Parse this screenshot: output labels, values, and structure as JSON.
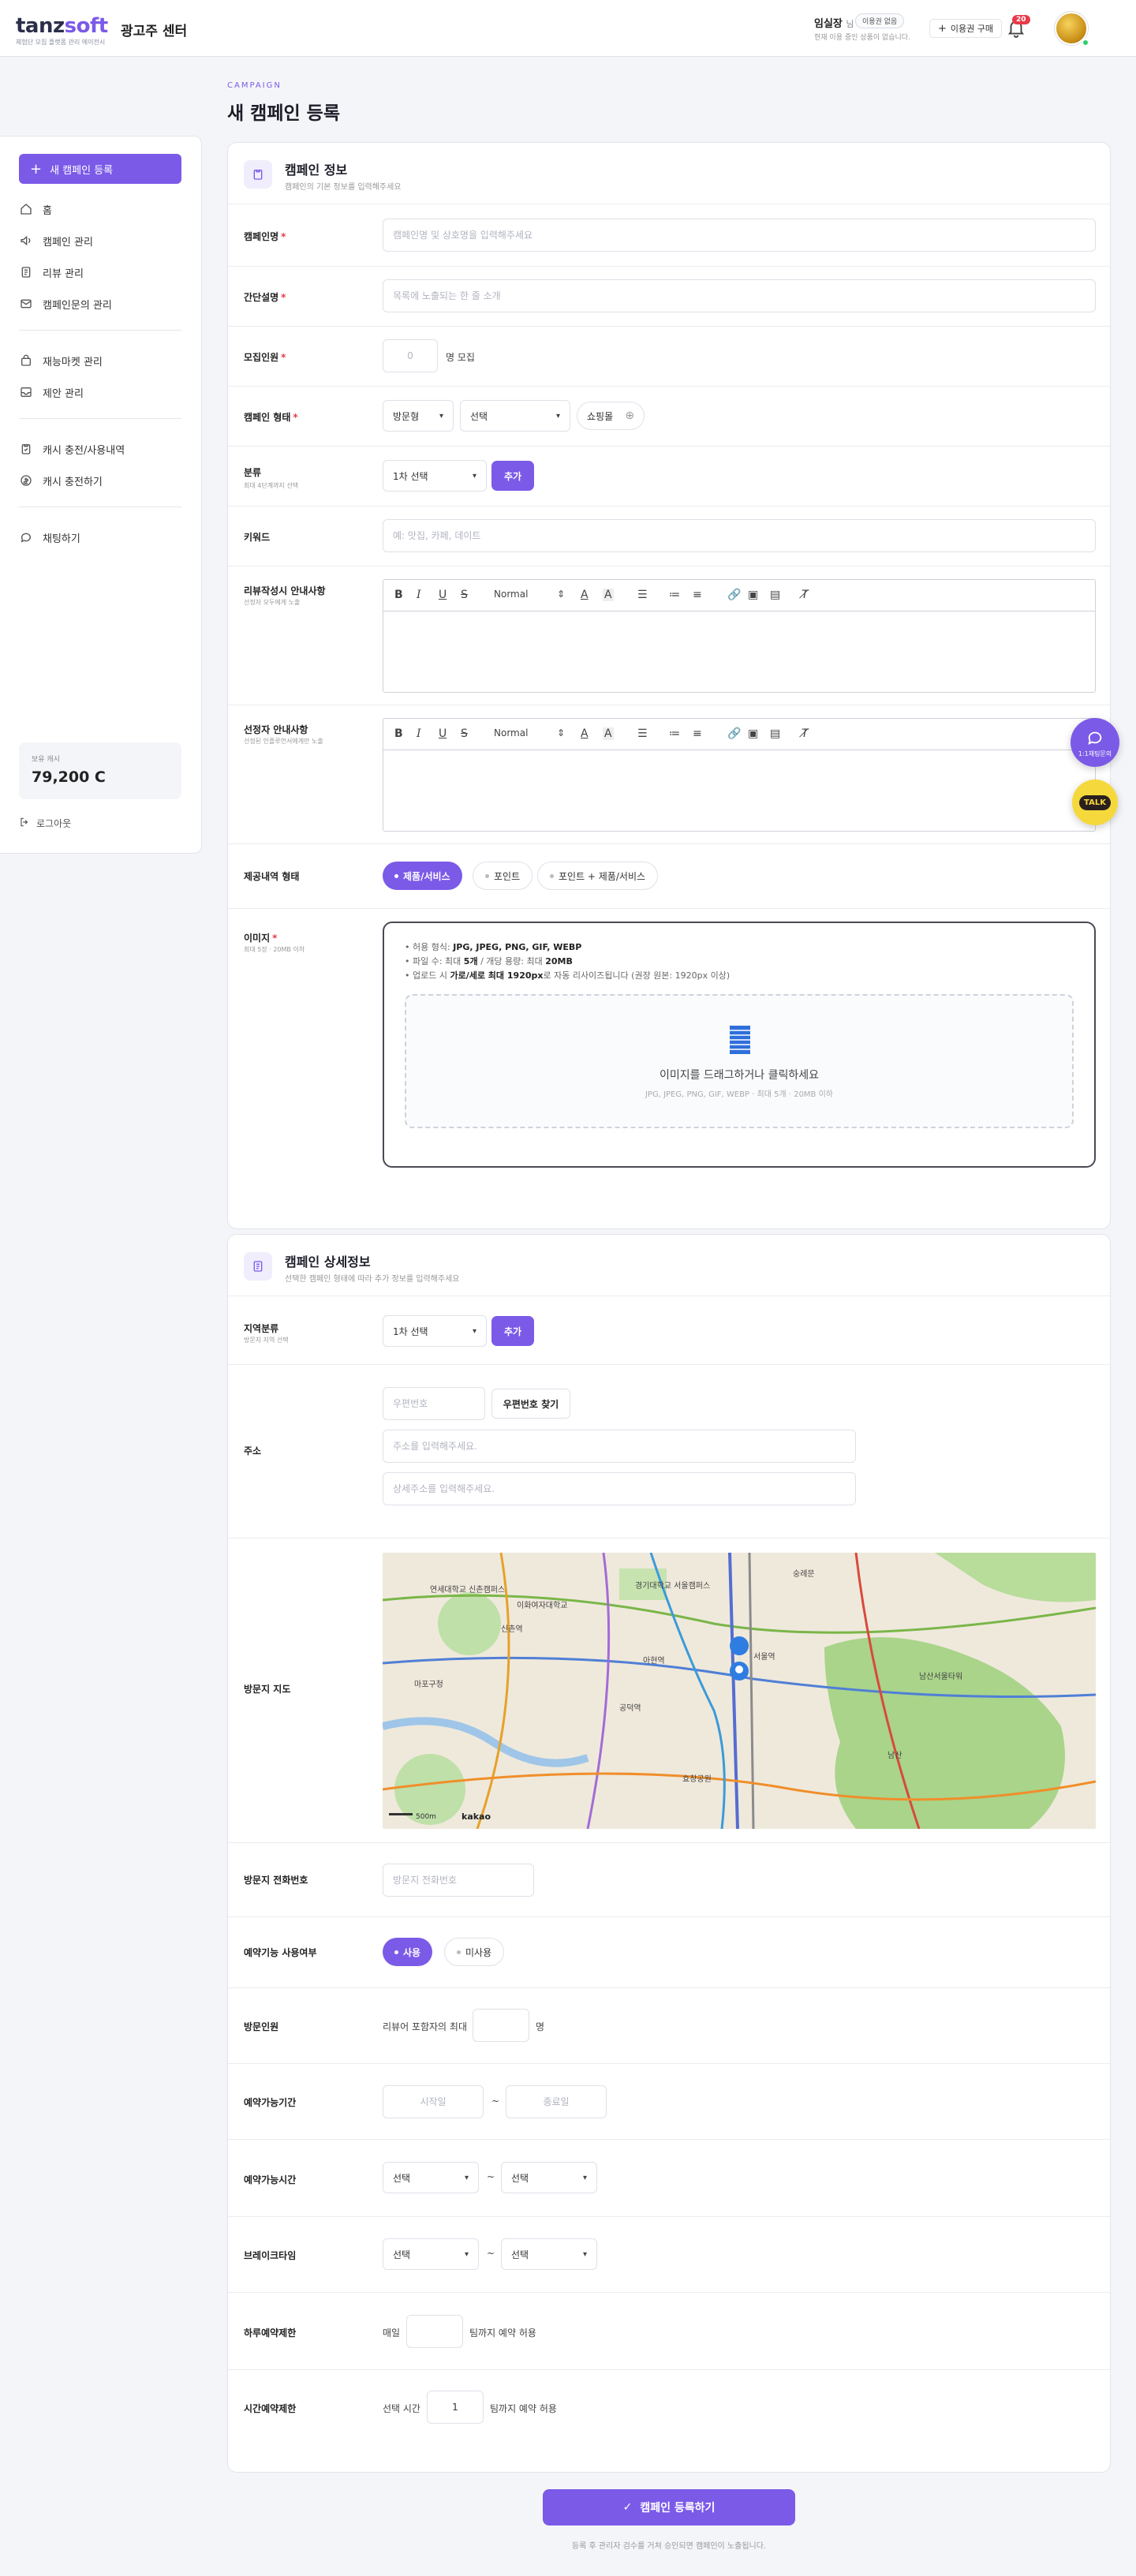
{
  "header": {
    "logo_main": "tanz",
    "logo_accent": "soft",
    "logo_sub": "체험단 모집 플랫폼 관리 에이전시",
    "center_title": "광고주 센터",
    "user_name": "임실장",
    "user_suffix": "님",
    "status_pill": "이용권 없음",
    "user_note": "현재 이용 중인 상품이 없습니다.",
    "buy_button": "이용권 구매",
    "notification_count": "20"
  },
  "sidebar": {
    "new_campaign": "새 캠페인 등록",
    "items": [
      {
        "label": "홈",
        "icon": "home-icon"
      },
      {
        "label": "캠페인 관리",
        "icon": "megaphone-icon"
      },
      {
        "label": "리뷰 관리",
        "icon": "document-icon"
      },
      {
        "label": "캠페인문의 관리",
        "icon": "mail-icon"
      },
      {
        "label": "재능마켓 관리",
        "icon": "bag-icon"
      },
      {
        "label": "제안 관리",
        "icon": "inbox-icon"
      },
      {
        "label": "캐시 충전/사용내역",
        "icon": "clipboard-icon"
      },
      {
        "label": "캐시 충전하기",
        "icon": "coin-icon"
      },
      {
        "label": "채팅하기",
        "icon": "chat-icon"
      }
    ],
    "cash_label": "보유 캐시",
    "cash_value": "79,200 C",
    "logout": "로그아웃"
  },
  "page": {
    "crumb": "CAMPAIGN",
    "title": "새 캠페인 등록"
  },
  "info_card": {
    "title": "캠페인 정보",
    "subtitle": "캠페인의 기본 정보를 입력해주세요",
    "name_label": "캠페인명",
    "name_placeholder": "캠페인명 및 상호명을 입력해주세요",
    "desc_label": "간단설명",
    "desc_placeholder": "목록에 노출되는 한 줄 소개",
    "recruit_label": "모집인원",
    "recruit_placeholder": "0",
    "recruit_suffix": "명 모집",
    "type_label": "캠페인 형태",
    "type_select1": "방문형",
    "type_select2": "선택",
    "type_tag": "쇼핑몰",
    "category_label": "분류",
    "category_sub": "최대 4단계까지 선택",
    "category_select": "1차 선택",
    "add_button": "추가",
    "keyword_label": "키워드",
    "keyword_placeholder": "예: 맛집, 카페, 데이트",
    "reviewer_guide_label": "리뷰작성시 안내사항",
    "reviewer_guide_sub": "선정자 모두에게 노출",
    "selected_guide_label": "선정자 안내사항",
    "selected_guide_sub": "선정된 인플루언서에게만 노출",
    "editor_style": "Normal",
    "reward_label": "제공내역 형태",
    "reward_options": [
      "제품/서비스",
      "포인트",
      "포인트 + 제품/서비스"
    ],
    "image_label": "이미지",
    "image_sub": "최대 5장 · 20MB 이하",
    "image_guides": [
      {
        "pre": "허용 형식: ",
        "bold": "JPG, JPEG, PNG, GIF, WEBP",
        "post": ""
      },
      {
        "pre": "파일 수: 최대 ",
        "bold": "5개",
        "post": " / 개당 용량: 최대 ",
        "bold2": "20MB"
      },
      {
        "pre": "업로드 시 ",
        "bold": "가로/세로 최대 1920px",
        "post": "로 자동 리사이즈됩니다 (권장 원본: 1920px 이상)"
      }
    ],
    "drop_text": "이미지를 드래그하거나 클릭하세요",
    "drop_sub": "JPG, JPEG, PNG, GIF, WEBP · 최대 5개 · 20MB 이하"
  },
  "detail_card": {
    "title": "캠페인 상세정보",
    "subtitle": "선택한 캠페인 형태에 따라 추가 정보를 입력해주세요",
    "region_label": "지역분류",
    "region_sub": "방문지 지역 선택",
    "region_select": "1차 선택",
    "add_button": "추가",
    "address_label": "주소",
    "postcode_placeholder": "우편번호",
    "postcode_button": "우편번호 찾기",
    "address_placeholder": "주소를 입력해주세요.",
    "address_detail_placeholder": "상세주소를 입력해주세요.",
    "map_label": "방문지 지도",
    "map_labels": [
      "연세대학교 신촌캠퍼스",
      "이화여자대학교",
      "경기대학교 서울캠퍼스",
      "서울역",
      "숭례문",
      "남산",
      "마포구청",
      "공덕역",
      "아현역",
      "신촌역",
      "효창공원",
      "남산서울타워"
    ],
    "map_scale": "500m",
    "map_brand": "kakao",
    "phone_label": "방문지 전화번호",
    "phone_placeholder": "방문지 전화번호",
    "reserve_label": "예약기능 사용여부",
    "reserve_options": [
      "사용",
      "미사용"
    ],
    "visitors_label": "방문인원",
    "visitors_pre": "리뷰어 포함자의 최대",
    "visitors_suffix": "명",
    "period_label": "예약가능기간",
    "period_start": "시작일",
    "period_end": "종료일",
    "range_sep": "~",
    "time_label": "예약가능시간",
    "time_start": "선택",
    "time_end": "선택",
    "break_label": "브레이크타임",
    "break_start": "선택",
    "break_end": "선택",
    "daily_label": "하루예약제한",
    "daily_pre": "매일",
    "daily_suffix": "팀까지 예약 허용",
    "slot_label": "시간예약제한",
    "slot_pre": "선택 시간",
    "slot_value": "1",
    "slot_suffix": "팀까지 예약 허용"
  },
  "submit": {
    "label": "캠페인 등록하기",
    "note": "등록 후 관리자 검수를 거쳐 승인되면 캠페인이 노출됩니다."
  },
  "floating": {
    "chat_label": "1:1채팅문의",
    "talk_label": "TALK"
  },
  "colors": {
    "accent": "#7b5ae8",
    "required": "#e83a4a",
    "badge": "#e83a4a",
    "online": "#2ccf6a"
  }
}
